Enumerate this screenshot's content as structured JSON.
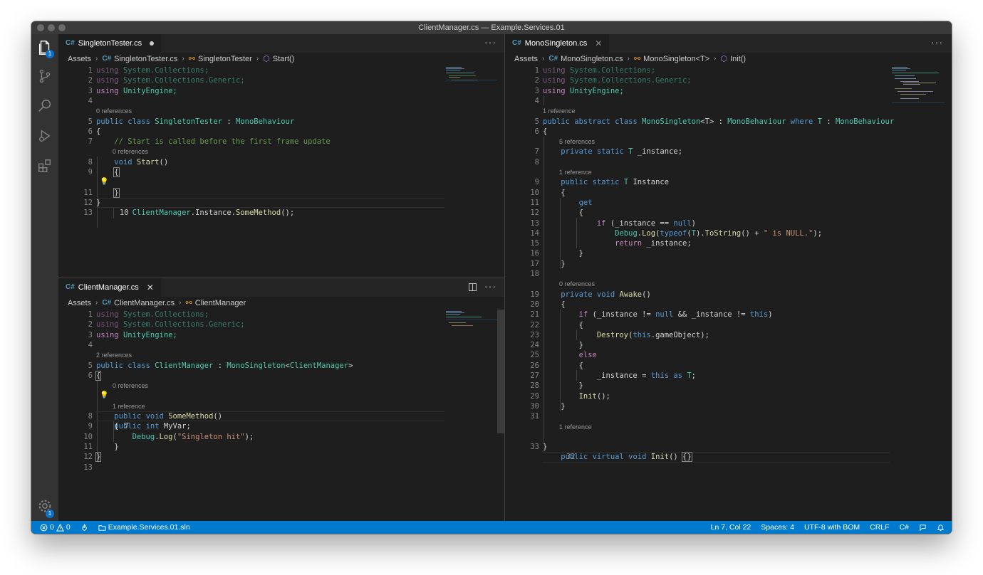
{
  "window": {
    "title": "ClientManager.cs — Example.Services.01"
  },
  "activity": {
    "explorer_badge": "1",
    "settings_badge": "1"
  },
  "panes": {
    "singleton_tester": {
      "tab_label": "SingletonTester.cs",
      "breadcrumb": [
        "Assets",
        "SingletonTester.cs",
        "SingletonTester",
        "Start()"
      ],
      "lenses": [
        "0 references",
        "0 references"
      ],
      "more": "···"
    },
    "client_manager": {
      "tab_label": "ClientManager.cs",
      "breadcrumb": [
        "Assets",
        "ClientManager.cs",
        "ClientManager"
      ],
      "lenses": [
        "2 references",
        "0 references",
        "1 reference"
      ],
      "more": "···"
    },
    "mono_singleton": {
      "tab_label": "MonoSingleton.cs",
      "breadcrumb": [
        "Assets",
        "MonoSingleton.cs",
        "MonoSingleton<T>",
        "Init()"
      ],
      "lenses": [
        "1 reference",
        "5 references",
        "1 reference",
        "0 references",
        "1 reference"
      ],
      "more": "···"
    }
  },
  "code": {
    "a": {
      "using": "using",
      "ns1": "System.Collections;",
      "ns2": "System.Collections.Generic;",
      "ns3": "UnityEngine;",
      "public": "public",
      "class": "class",
      "name": "SingletonTester",
      "colon": " : ",
      "base": "MonoBehaviour",
      "comment": "// Start is called before the first frame update",
      "void": "void",
      "start": "Start",
      "paren": "()",
      "cm_obj": "ClientManager",
      "dot_inst": ".Instance.",
      "some": "SomeMethod",
      "call_end": "();"
    },
    "b": {
      "name": "ClientManager",
      "base": "MonoSingleton",
      "gen_open": "<",
      "gen_close": ">",
      "int": "int",
      "myvar": "MyVar",
      "semi": ";",
      "some": "SomeMethod",
      "debug": "Debug",
      "dotlog": ".",
      "log": "Log",
      "lp": "(",
      "str": "\"Singleton hit\"",
      "rp": ");"
    },
    "c": {
      "abstract": "abstract",
      "name": "MonoSingleton",
      "t_gen": "<T>",
      "base": "MonoBehaviour",
      "where": "where",
      "t": "T",
      "private": "private",
      "static": "static",
      "inst": "_instance",
      "instance_prop": "Instance",
      "get": "get",
      "if": "if",
      "eq": " == ",
      "null": "null",
      "typeof": "typeof",
      "tostring": "ToString",
      "plus": " + ",
      "isnull": "\" is NULL.\"",
      "return": "return",
      "awake": "Awake",
      "neq": " != ",
      "and": " && ",
      "this": "this",
      "destroy": "Destroy",
      "go": "gameObject",
      "else": "else",
      "as": "as",
      "init": "Init",
      "virtual": "virtual",
      "braces": "{}"
    },
    "open_brace": "{",
    "close_brace": "}",
    "empty_paren": "()",
    "semi": ";",
    "lp": "(",
    "rp": ")",
    "dot": ".",
    "assign": " = "
  },
  "status": {
    "problems": "0",
    "warnings": "0",
    "solution": "Example.Services.01.sln",
    "position": "Ln 7, Col 22",
    "spaces": "Spaces: 4",
    "encoding": "UTF-8 with BOM",
    "eol": "CRLF",
    "language": "C#"
  },
  "colors": {
    "status_bar": "#007acc",
    "editor_bg": "#1e1e1e",
    "keyword": "#569cd6",
    "type": "#4ec9b0",
    "function": "#dcdcaa",
    "string": "#ce9178",
    "comment": "#6a9955"
  },
  "icons": [
    "files-icon",
    "source-control-icon",
    "search-icon",
    "run-debug-icon",
    "extensions-icon",
    "settings-gear-icon",
    "csharp-file-icon",
    "class-icon",
    "method-icon",
    "lightbulb-icon",
    "split-editor-icon",
    "error-icon",
    "warning-icon",
    "flame-icon",
    "folder-icon",
    "feedback-icon",
    "bell-icon"
  ]
}
